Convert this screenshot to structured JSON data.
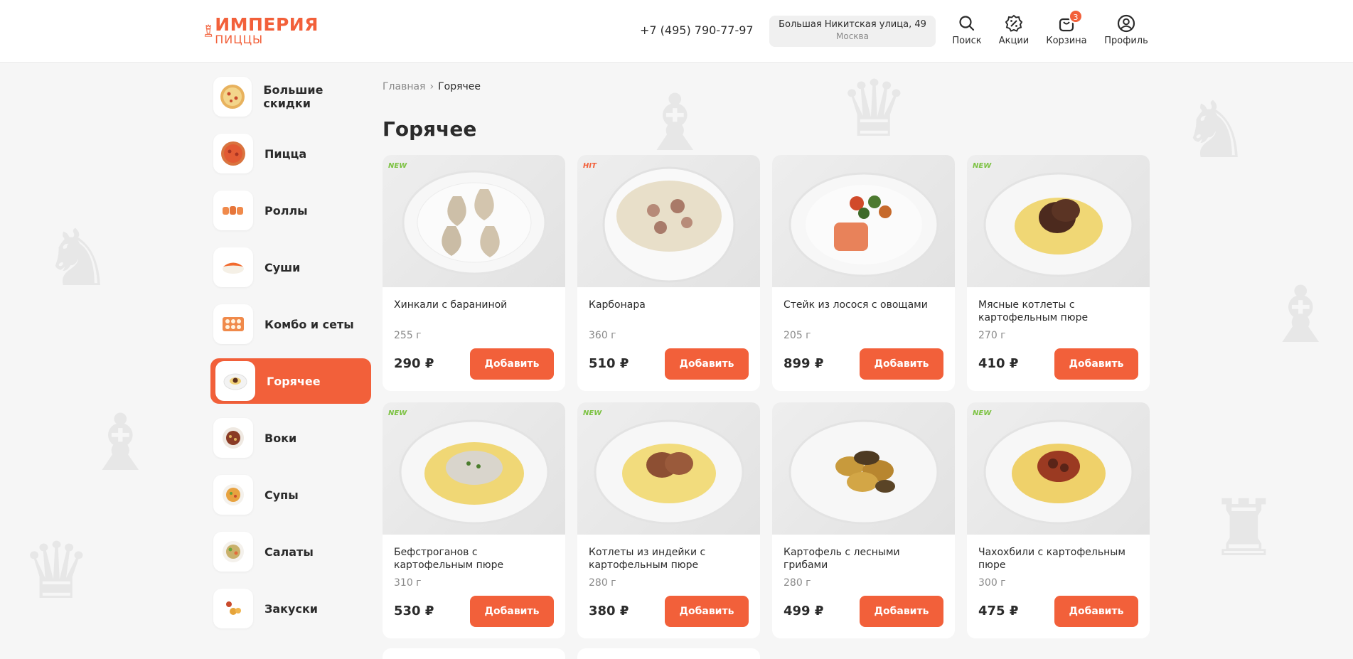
{
  "brand": {
    "name": "ИМПЕРИЯ",
    "sub": "ПИЦЦЫ",
    "accent": "#f2603a"
  },
  "header": {
    "phone": "+7 (495) 790-77-97",
    "address": {
      "street": "Большая Никитская улица, 49",
      "city": "Москва"
    },
    "nav": {
      "search": "Поиск",
      "promos": "Акции",
      "cart": "Корзина",
      "cart_count": "3",
      "profile": "Профиль"
    }
  },
  "sidebar": {
    "items": [
      {
        "label": "Большие скидки",
        "icon": "pizza-icon",
        "active": false
      },
      {
        "label": "Пицца",
        "icon": "pizza-icon",
        "active": false
      },
      {
        "label": "Роллы",
        "icon": "rolls-icon",
        "active": false
      },
      {
        "label": "Суши",
        "icon": "sushi-icon",
        "active": false
      },
      {
        "label": "Комбо и сеты",
        "icon": "combo-icon",
        "active": false
      },
      {
        "label": "Горячее",
        "icon": "hot-dish-icon",
        "active": true
      },
      {
        "label": "Воки",
        "icon": "wok-icon",
        "active": false
      },
      {
        "label": "Супы",
        "icon": "soup-icon",
        "active": false
      },
      {
        "label": "Салаты",
        "icon": "salad-icon",
        "active": false
      },
      {
        "label": "Закуски",
        "icon": "snacks-icon",
        "active": false
      }
    ]
  },
  "breadcrumb": {
    "home": "Главная",
    "current": "Горячее"
  },
  "page": {
    "title": "Горячее"
  },
  "products": [
    {
      "name": "Хинкали с бараниной",
      "weight": "255 г",
      "price": "290 ₽",
      "button": "Добавить",
      "badge": "NEW",
      "dish": "khinkali"
    },
    {
      "name": "Карбонара",
      "weight": "360 г",
      "price": "510 ₽",
      "button": "Добавить",
      "badge": "HIT",
      "dish": "pasta"
    },
    {
      "name": "Стейк из лосося с овощами",
      "weight": "205 г",
      "price": "899 ₽",
      "button": "Добавить",
      "badge": "",
      "dish": "salmon"
    },
    {
      "name": "Мясные котлеты с картофельным пюре",
      "weight": "270 г",
      "price": "410 ₽",
      "button": "Добавить",
      "badge": "NEW",
      "dish": "cutlet"
    },
    {
      "name": "Бефстроганов с картофельным пюре",
      "weight": "310 г",
      "price": "530 ₽",
      "button": "Добавить",
      "badge": "NEW",
      "dish": "stroganoff"
    },
    {
      "name": "Котлеты из индейки с картофельным пюре",
      "weight": "280 г",
      "price": "380 ₽",
      "button": "Добавить",
      "badge": "NEW",
      "dish": "turkey"
    },
    {
      "name": "Картофель с лесными грибами",
      "weight": "280 г",
      "price": "499 ₽",
      "button": "Добавить",
      "badge": "",
      "dish": "potato"
    },
    {
      "name": "Чахохбили с картофельным пюре",
      "weight": "300 г",
      "price": "475 ₽",
      "button": "Добавить",
      "badge": "NEW",
      "dish": "chakhokhbili"
    }
  ]
}
